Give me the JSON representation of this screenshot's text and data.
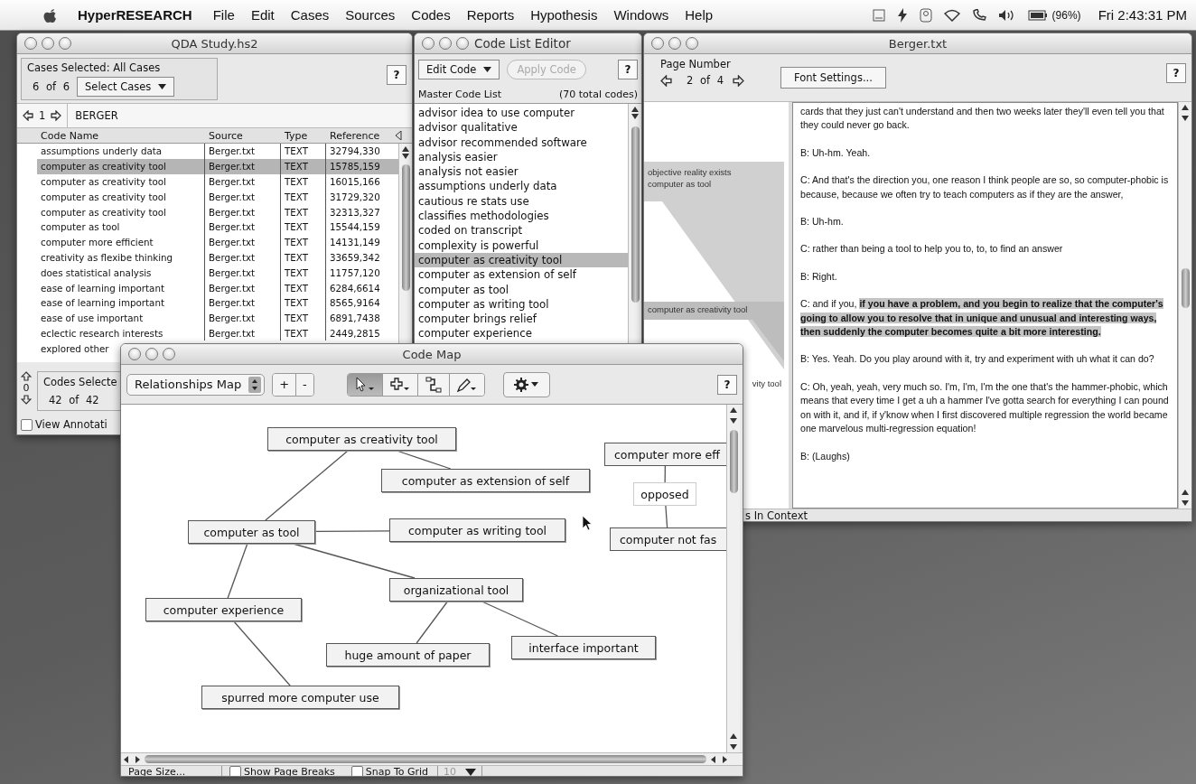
{
  "menu_bar": {
    "app_name": "HyperRESEARCH",
    "menus": [
      "File",
      "Edit",
      "Cases",
      "Sources",
      "Codes",
      "Reports",
      "Hypothesis",
      "Windows",
      "Help"
    ],
    "battery": "(96%)",
    "clock": "Fri 2:43:31 PM"
  },
  "qda_window": {
    "title": "QDA Study.hs2",
    "cases_label": "Cases Selected:  All Cases",
    "cases_count": "6  of  6",
    "select_cases": "Select Cases",
    "help": "?",
    "case_number": "1",
    "case_name": "BERGER",
    "columns": [
      "Code Name",
      "Source",
      "Type",
      "Reference"
    ],
    "rows": [
      {
        "code": "assumptions underly data",
        "source": "Berger.txt",
        "type": "TEXT",
        "reference": "32794,330",
        "selected": false
      },
      {
        "code": "computer as creativity tool",
        "source": "Berger.txt",
        "type": "TEXT",
        "reference": "15785,159",
        "selected": true
      },
      {
        "code": "computer as creativity tool",
        "source": "Berger.txt",
        "type": "TEXT",
        "reference": "16015,166",
        "selected": false
      },
      {
        "code": "computer as creativity tool",
        "source": "Berger.txt",
        "type": "TEXT",
        "reference": "31729,320",
        "selected": false
      },
      {
        "code": "computer as creativity tool",
        "source": "Berger.txt",
        "type": "TEXT",
        "reference": "32313,327",
        "selected": false
      },
      {
        "code": "computer as tool",
        "source": "Berger.txt",
        "type": "TEXT",
        "reference": "15544,159",
        "selected": false
      },
      {
        "code": "computer more efficient",
        "source": "Berger.txt",
        "type": "TEXT",
        "reference": "14131,149",
        "selected": false
      },
      {
        "code": "creativity as flexibe thinking",
        "source": "Berger.txt",
        "type": "TEXT",
        "reference": "33659,342",
        "selected": false
      },
      {
        "code": "does statistical analysis",
        "source": "Berger.txt",
        "type": "TEXT",
        "reference": "11757,120",
        "selected": false
      },
      {
        "code": "ease of learning important",
        "source": "Berger.txt",
        "type": "TEXT",
        "reference": "6284,6614",
        "selected": false
      },
      {
        "code": "ease of learning important",
        "source": "Berger.txt",
        "type": "TEXT",
        "reference": "8565,9164",
        "selected": false
      },
      {
        "code": "ease of use important",
        "source": "Berger.txt",
        "type": "TEXT",
        "reference": "6891,7438",
        "selected": false
      },
      {
        "code": "eclectic research interests",
        "source": "Berger.txt",
        "type": "TEXT",
        "reference": "2449,2815",
        "selected": false
      },
      {
        "code": "explored other",
        "selected": false
      }
    ],
    "codes_count": "0",
    "codes_selected_label": "Codes Selecte",
    "codes_selected_count": "42  of  42",
    "view_annotations": {
      "label": "View Annotati",
      "checked": false
    }
  },
  "code_list_editor": {
    "title": "Code List Editor",
    "edit_code": "Edit Code",
    "apply_code": {
      "label": "Apply Code",
      "disabled": true
    },
    "help": "?",
    "list_label": "Master Code List",
    "total": "(70 total codes)",
    "items": [
      {
        "label": "advisor idea to use computer",
        "selected": false
      },
      {
        "label": "advisor qualitative",
        "selected": false
      },
      {
        "label": "advisor recommended software",
        "selected": false
      },
      {
        "label": "analysis easier",
        "selected": false
      },
      {
        "label": "analysis not easier",
        "selected": false
      },
      {
        "label": "assumptions underly data",
        "selected": false
      },
      {
        "label": "cautious re stats use",
        "selected": false
      },
      {
        "label": "classifies methodologies",
        "selected": false
      },
      {
        "label": "coded on transcript",
        "selected": false
      },
      {
        "label": "complexity is powerful",
        "selected": false
      },
      {
        "label": "computer as creativity tool",
        "selected": true
      },
      {
        "label": "computer as extension of self",
        "selected": false
      },
      {
        "label": "computer as tool",
        "selected": false
      },
      {
        "label": "computer as writing tool",
        "selected": false
      },
      {
        "label": "computer brings relief",
        "selected": false
      },
      {
        "label": "computer experience",
        "selected": false
      }
    ]
  },
  "berger_window": {
    "title": "Berger.txt",
    "page_label": "Page Number",
    "page": "2  of  4",
    "font_settings": "Font Settings...",
    "help": "?",
    "margin": [
      {
        "kind": "bracket",
        "lines": [
          "objective reality exists",
          "computer as tool"
        ]
      },
      {
        "kind": "band",
        "lines": [
          "computer as creativity tool"
        ]
      },
      {
        "kind": "plain",
        "lines": [
          "vity tool"
        ]
      }
    ],
    "paragraphs": [
      {
        "text": "cards that they just can't understand and then two weeks later they'll even tell you that they could never go back."
      },
      {
        "text": "B:  Uh-hm.  Yeah."
      },
      {
        "text": "C:  And that's the direction you, one reason I think people are so, so computer-phobic is because, because we often try to teach computers as if they are the answer,"
      },
      {
        "text": "B:  Uh-hm."
      },
      {
        "text": "C:  rather than being a tool to help you to, to, to find an answer"
      },
      {
        "text": "B:  Right."
      },
      {
        "text": "C:  and if you,",
        "highlight": "if you have a problem, and you begin to realize that the computer's going to allow you to resolve that in unique and unusual and interesting ways, then suddenly the computer becomes quite a bit more interesting."
      },
      {
        "text": "B:  Yes.  Yeah.  Do you play around with it, try and experiment with uh what it can do?"
      },
      {
        "text": "C:  Oh, yeah, yeah, very much so.  I'm, I'm, I'm the one that's the hammer-phobic, which means that every time I get a uh a hammer I've gotta search for everything I can pound on with it, and if, if y'know when I first discovered multiple regression the world became one marvelous multi-regression equation!"
      },
      {
        "text": "B:  (Laughs)"
      }
    ],
    "footer": "s In Context"
  },
  "code_map": {
    "title": "Code Map",
    "map_type": "Relationships Map",
    "zoom_in": "+",
    "zoom_out": "-",
    "help": "?",
    "tools": [
      {
        "kind": "pointer",
        "selected": true
      },
      {
        "kind": "add",
        "selected": false
      },
      {
        "kind": "link",
        "selected": false
      },
      {
        "kind": "pen",
        "selected": false
      }
    ],
    "nodes": [
      {
        "label": "computer as creativity tool",
        "kind": "code"
      },
      {
        "label": "computer as extension of self",
        "kind": "code"
      },
      {
        "label": "computer as tool",
        "kind": "code"
      },
      {
        "label": "computer as writing tool",
        "kind": "code"
      },
      {
        "label": "organizational tool",
        "kind": "code"
      },
      {
        "label": "computer experience",
        "kind": "code"
      },
      {
        "label": "huge amount of paper",
        "kind": "code"
      },
      {
        "label": "interface important",
        "kind": "code"
      },
      {
        "label": "spurred more computer use",
        "kind": "code"
      },
      {
        "label": "computer more eff",
        "kind": "code"
      },
      {
        "label": "opposed",
        "kind": "relation"
      },
      {
        "label": "computer not fas",
        "kind": "code"
      }
    ],
    "page_size": "Page Size...",
    "show_page_breaks": {
      "label": "Show Page Breaks",
      "checked": false
    },
    "snap_to_grid": {
      "label": "Snap To Grid",
      "checked": false
    },
    "grid_size": "10"
  }
}
